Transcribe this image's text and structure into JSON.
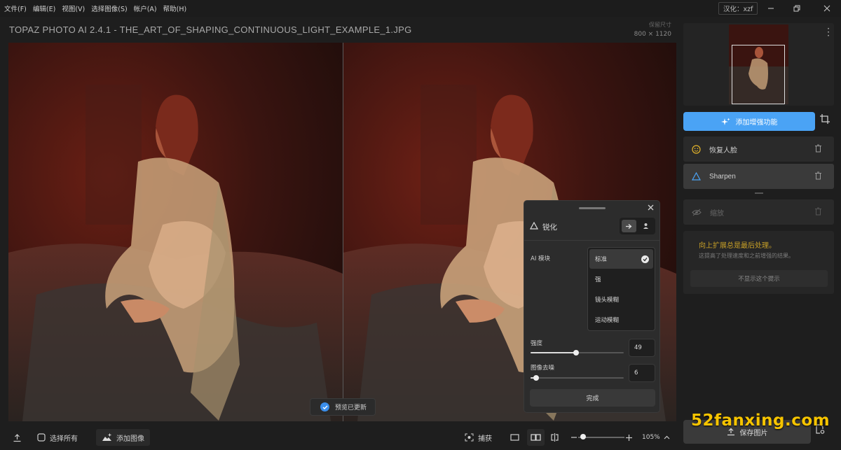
{
  "menu": [
    "文件(F)",
    "编辑(E)",
    "视图(V)",
    "选择图像(S)",
    "帐户(A)",
    "帮助(H)"
  ],
  "localization": "汉化：xzf",
  "window": {
    "title": "TOPAZ PHOTO AI 2.4.1 - THE_ART_OF_SHAPING_CONTINUOUS_LIGHT_EXAMPLE_1.JPG"
  },
  "image_size": {
    "label": "保留尺寸",
    "value": "800 × 1120"
  },
  "toast": "预览已更新",
  "sharpen_panel": {
    "title": "锐化",
    "ai_model_label": "AI 模块",
    "options": [
      "标准",
      "强",
      "镜头模糊",
      "运动模糊"
    ],
    "selected": "标准",
    "strength_label": "强度",
    "strength_value": "49",
    "strength_level": 0.49,
    "denoise_label": "图像去噪",
    "denoise_value": "6",
    "denoise_level": 0.06,
    "done_label": "完成"
  },
  "bottom": {
    "select_all": "选择所有",
    "add_image": "添加图像",
    "capture": "捕获",
    "zoom": "105%"
  },
  "sidebar": {
    "add_enhancement": "添加增强功能",
    "filters": [
      {
        "label": "恢复人脸",
        "icon": "face-icon",
        "state": "normal"
      },
      {
        "label": "Sharpen",
        "icon": "triangle-icon",
        "state": "active"
      },
      {
        "label": "缩放",
        "icon": "eye-off-icon",
        "state": "disabled"
      }
    ],
    "tip_title": "向上扩展总是最后处理。",
    "tip_text": "这提高了处理速度和之前增强的结果。",
    "tip_dismiss": "不显示这个提示",
    "save_label": "保存图片"
  },
  "watermark": "52fanxing.com",
  "colors": {
    "accent": "#4aa3f5",
    "tip": "#c8a027",
    "watermark": "#f6c400"
  }
}
